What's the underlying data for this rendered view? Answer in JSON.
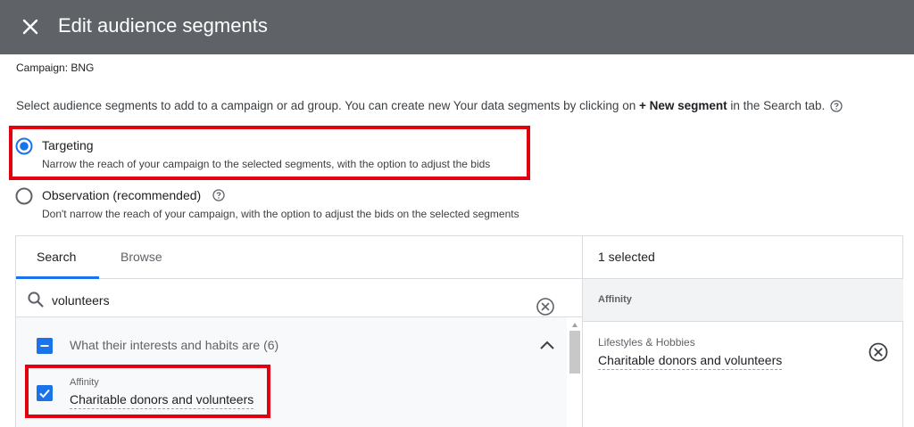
{
  "dialog": {
    "title": "Edit audience segments"
  },
  "campaign": {
    "label": "Campaign: BNG"
  },
  "intro": {
    "prefix": "Select audience segments to add to a campaign or ad group. You can create new Your data segments by clicking on ",
    "bold": "+ New segment",
    "suffix": " in the Search tab."
  },
  "options": [
    {
      "label": "Targeting",
      "description": "Narrow the reach of your campaign to the selected segments, with the option to adjust the bids",
      "selected": true
    },
    {
      "label": "Observation (recommended)",
      "description": "Don't narrow the reach of your campaign, with the option to adjust the bids on the selected segments",
      "selected": false
    }
  ],
  "tabs": {
    "search": "Search",
    "browse": "Browse",
    "active": "Search"
  },
  "search": {
    "value": "volunteers",
    "placeholder": ""
  },
  "results": {
    "group_label": "What their interests and habits are (6)",
    "item_category": "Affinity",
    "item_name": "Charitable donors and volunteers",
    "item_checked": true
  },
  "selection": {
    "count_label": "1 selected",
    "section_header": "Affinity",
    "item_category": "Lifestyles & Hobbies",
    "item_name": "Charitable donors and volunteers"
  },
  "colors": {
    "header_bg": "#5f6368",
    "accent": "#1a73e8",
    "highlight": "#e3000f"
  },
  "icons": [
    "close-icon",
    "help-icon",
    "search-icon",
    "clear-icon",
    "chevron-up-icon",
    "remove-icon",
    "checkbox-indeterminate-icon",
    "checkbox-checked-icon"
  ]
}
